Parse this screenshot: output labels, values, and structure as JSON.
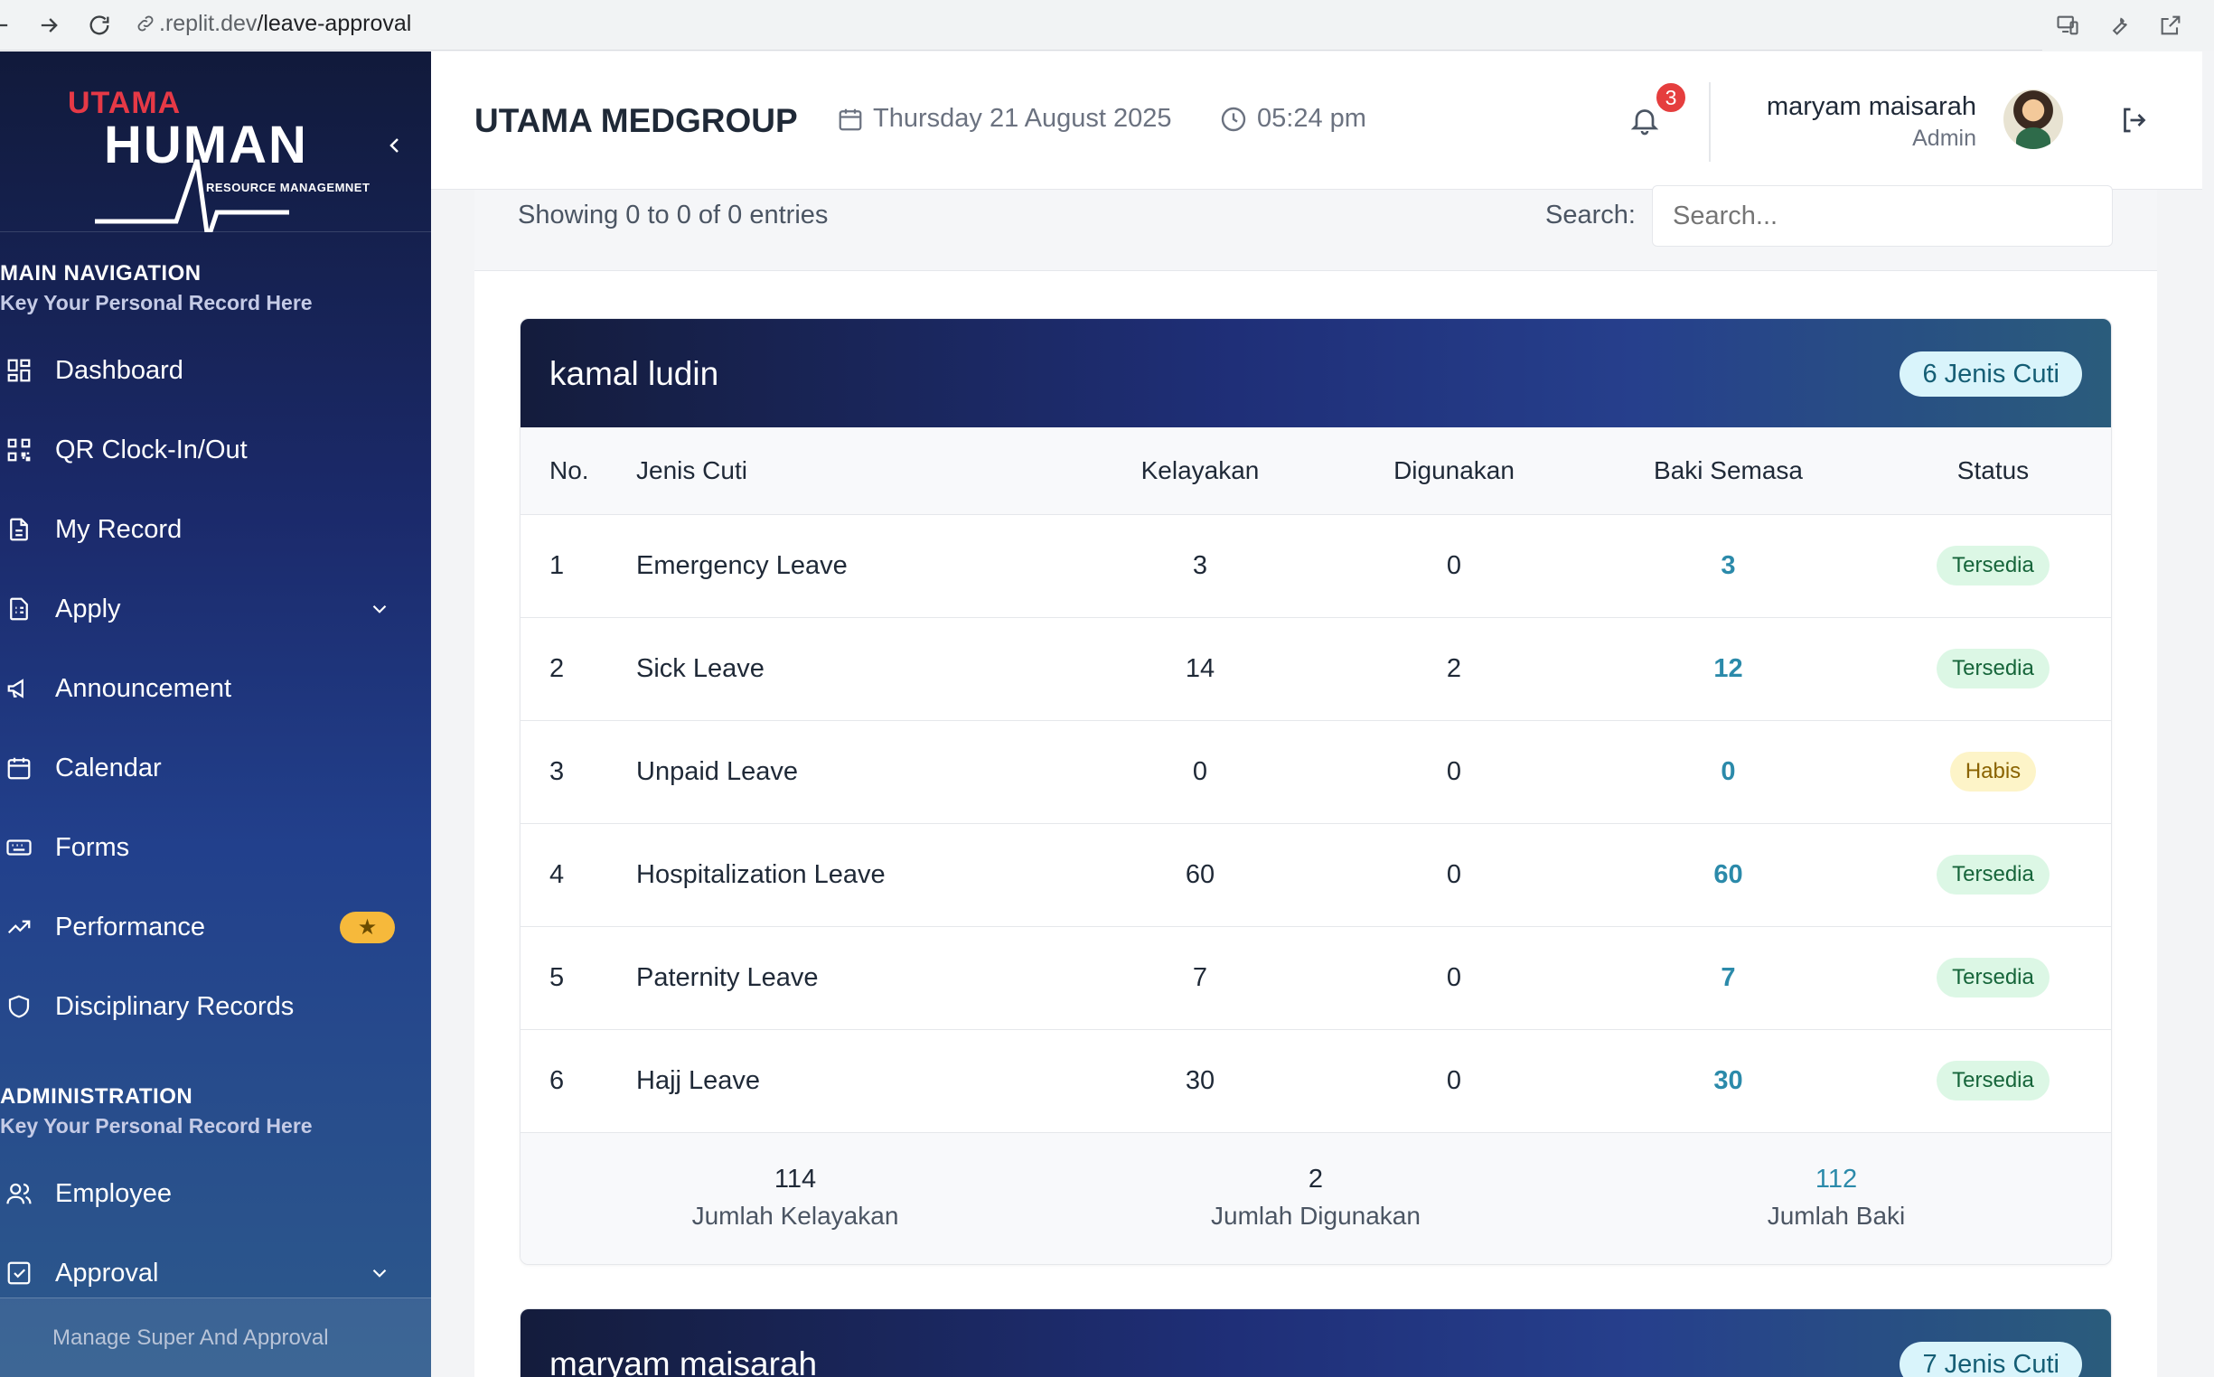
{
  "browser": {
    "url_domain": ".replit.dev",
    "url_path": "/leave-approval"
  },
  "sidebar": {
    "logo_utama": "UTAMA",
    "logo_human": "HUMAN",
    "logo_sub": "RESOURCE MANAGEMNET",
    "main_nav_title": "MAIN NAVIGATION",
    "main_nav_sub": "Key Your Personal Record Here",
    "items": [
      {
        "label": "Dashboard",
        "icon": "grid-icon"
      },
      {
        "label": "QR Clock-In/Out",
        "icon": "qr-icon"
      },
      {
        "label": "My Record",
        "icon": "document-icon"
      },
      {
        "label": "Apply",
        "icon": "form-icon"
      },
      {
        "label": "Announcement",
        "icon": "megaphone-icon"
      },
      {
        "label": "Calendar",
        "icon": "calendar-icon"
      },
      {
        "label": "Forms",
        "icon": "keyboard-icon"
      },
      {
        "label": "Performance",
        "icon": "trend-icon",
        "badge": "★"
      },
      {
        "label": "Disciplinary Records",
        "icon": "shield-icon"
      }
    ],
    "admin_title": "ADMINISTRATION",
    "admin_sub": "Key Your Personal Record Here",
    "admin_items": [
      {
        "label": "Employee",
        "icon": "users-icon"
      },
      {
        "label": "Approval",
        "icon": "check-square-icon"
      }
    ],
    "sub_item": "Manage Super And Approval"
  },
  "header": {
    "company": "UTAMA MEDGROUP",
    "date": "Thursday 21 August 2025",
    "time": "05:24 pm",
    "notification_count": "3",
    "user_name": "maryam maisarah",
    "user_role": "Admin"
  },
  "table_controls": {
    "showing": "Showing 0 to 0 of 0 entries",
    "search_label": "Search:",
    "search_placeholder": "Search..."
  },
  "columns": [
    "No.",
    "Jenis Cuti",
    "Kelayakan",
    "Digunakan",
    "Baki Semasa",
    "Status"
  ],
  "cards": [
    {
      "name": "kamal ludin",
      "pill": "6 Jenis Cuti",
      "rows": [
        {
          "no": "1",
          "jenis": "Emergency Leave",
          "kel": "3",
          "dig": "0",
          "baki": "3",
          "status": "Tersedia"
        },
        {
          "no": "2",
          "jenis": "Sick Leave",
          "kel": "14",
          "dig": "2",
          "baki": "12",
          "status": "Tersedia"
        },
        {
          "no": "3",
          "jenis": "Unpaid Leave",
          "kel": "0",
          "dig": "0",
          "baki": "0",
          "status": "Habis"
        },
        {
          "no": "4",
          "jenis": "Hospitalization Leave",
          "kel": "60",
          "dig": "0",
          "baki": "60",
          "status": "Tersedia"
        },
        {
          "no": "5",
          "jenis": "Paternity Leave",
          "kel": "7",
          "dig": "0",
          "baki": "7",
          "status": "Tersedia"
        },
        {
          "no": "6",
          "jenis": "Hajj Leave",
          "kel": "30",
          "dig": "0",
          "baki": "30",
          "status": "Tersedia"
        }
      ],
      "summary": {
        "kelayakan": "114",
        "kelayakan_label": "Jumlah Kelayakan",
        "digunakan": "2",
        "digunakan_label": "Jumlah Digunakan",
        "baki": "112",
        "baki_label": "Jumlah Baki"
      }
    },
    {
      "name": "maryam maisarah",
      "pill": "7 Jenis Cuti"
    }
  ],
  "colors": {
    "accent": "#2b8aaa",
    "status_available_bg": "#dcf7e5",
    "status_exhausted_bg": "#fdf4c8",
    "badge_red": "#e53e3e"
  }
}
